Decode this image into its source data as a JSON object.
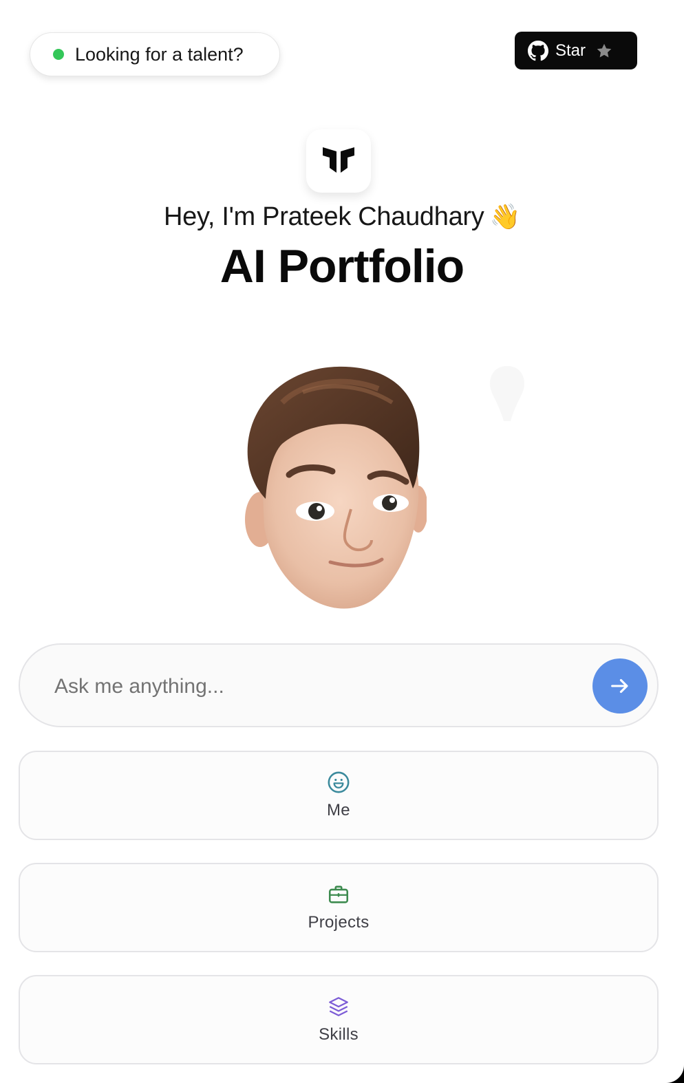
{
  "header": {
    "talent_label": "Looking for a talent?",
    "github_star_label": "Star",
    "status_color": "#34c759"
  },
  "hero": {
    "greeting": "Hey, I'm Prateek Chaudhary",
    "wave_emoji": "👋",
    "title": "AI Portfolio",
    "logo_icon": "logo-icon",
    "avatar": "memoji-avatar"
  },
  "chat": {
    "placeholder": "Ask me anything...",
    "value": "",
    "send_icon": "arrow-right-icon",
    "accent": "#5b8ee6"
  },
  "quick_actions": [
    {
      "label": "Me",
      "icon": "smile-icon",
      "color": "#3b8a9c"
    },
    {
      "label": "Projects",
      "icon": "briefcase-icon",
      "color": "#3d8b4f"
    },
    {
      "label": "Skills",
      "icon": "layers-icon",
      "color": "#7c5cd6"
    }
  ]
}
